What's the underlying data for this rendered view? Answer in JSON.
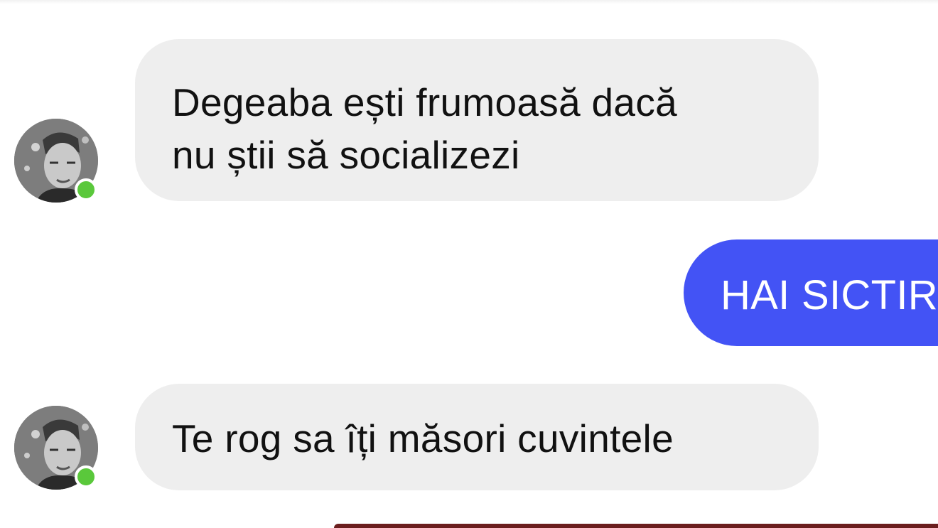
{
  "messages": [
    {
      "sender": "contact",
      "lines": [
        "Degeaba ești frumoasă dacă",
        "nu știi să socializezi"
      ],
      "online": true
    },
    {
      "sender": "me",
      "text": "HAI SICTIR"
    },
    {
      "sender": "contact",
      "lines": [
        "Te rog sa îți măsori cuvintele"
      ],
      "online": true
    }
  ],
  "colors": {
    "incoming_bubble": "#eeeeee",
    "outgoing_bubble": "#4353f5",
    "online_indicator": "#5ac83b"
  },
  "icons": {
    "contact_avatar": "profile-photo-icon",
    "presence": "online-status-icon"
  }
}
